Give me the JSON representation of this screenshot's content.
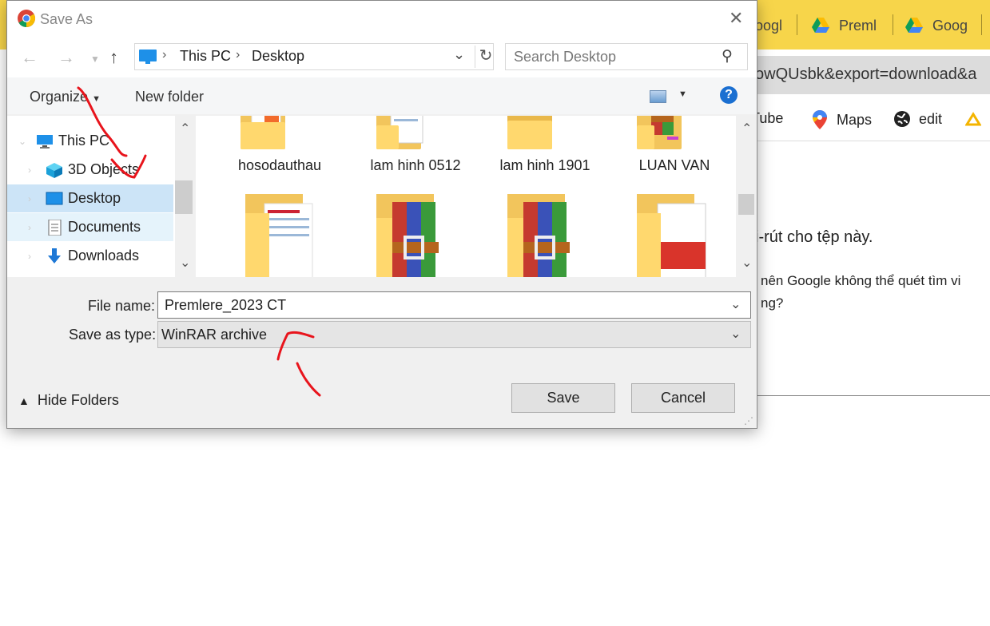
{
  "browser": {
    "tabs": [
      "oogl",
      "Preml",
      "Goog"
    ],
    "url_fragment": "owQUsbk&export=download&a",
    "bookmarks": [
      "uTube",
      "Maps",
      "edit"
    ],
    "page_text": [
      "i-rút cho tệp này.",
      "nên Google không thể quét tìm vi",
      "ng?"
    ]
  },
  "dialog": {
    "title": "Save As",
    "close": "✕",
    "address": {
      "crumbs": [
        "This PC",
        "Desktop"
      ]
    },
    "search_placeholder": "Search Desktop",
    "toolbar": {
      "organize": "Organize",
      "new_folder": "New folder",
      "help": "?"
    },
    "nav_items": [
      {
        "label": "This PC",
        "icon": "computer-icon"
      },
      {
        "label": "3D Objects",
        "icon": "cube-icon"
      },
      {
        "label": "Desktop",
        "icon": "desktop-icon",
        "selected": true
      },
      {
        "label": "Documents",
        "icon": "documents-icon",
        "hovered": true
      },
      {
        "label": "Downloads",
        "icon": "downloads-icon"
      }
    ],
    "files_row1": [
      "hosodauthau",
      "lam hinh 0512",
      "lam hinh 1901",
      "LUAN VAN"
    ],
    "file_name_label": "File name:",
    "file_name_value": "Premlere_2023 CT",
    "save_type_label": "Save as type:",
    "save_type_value": "WinRAR archive",
    "hide_folders": "Hide Folders",
    "save": "Save",
    "cancel": "Cancel"
  }
}
